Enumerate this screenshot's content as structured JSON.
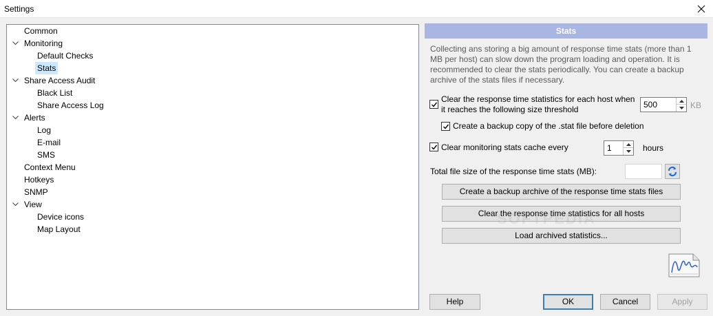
{
  "window": {
    "title": "Settings"
  },
  "tree": {
    "items": [
      {
        "label": "Common",
        "expanded": null,
        "level": 0
      },
      {
        "label": "Monitoring",
        "expanded": true,
        "level": 0
      },
      {
        "label": "Default Checks",
        "expanded": null,
        "level": 1
      },
      {
        "label": "Stats",
        "expanded": null,
        "level": 1,
        "selected": true
      },
      {
        "label": "Share Access Audit",
        "expanded": true,
        "level": 0
      },
      {
        "label": "Black List",
        "expanded": null,
        "level": 1
      },
      {
        "label": "Share Access Log",
        "expanded": null,
        "level": 1
      },
      {
        "label": "Alerts",
        "expanded": true,
        "level": 0
      },
      {
        "label": "Log",
        "expanded": null,
        "level": 1
      },
      {
        "label": "E-mail",
        "expanded": null,
        "level": 1
      },
      {
        "label": "SMS",
        "expanded": null,
        "level": 1
      },
      {
        "label": "Context Menu",
        "expanded": null,
        "level": 0
      },
      {
        "label": "Hotkeys",
        "expanded": null,
        "level": 0
      },
      {
        "label": "SNMP",
        "expanded": null,
        "level": 0
      },
      {
        "label": "View",
        "expanded": true,
        "level": 0
      },
      {
        "label": "Device icons",
        "expanded": null,
        "level": 1
      },
      {
        "label": "Map Layout",
        "expanded": null,
        "level": 1
      }
    ]
  },
  "panel": {
    "header": "Stats",
    "description": "Collecting ans storing a big amount of response time stats (more than 1 MB per host) can slow down the program loading and operation. It is recommended to clear the stats periodically. You can create a backup archive of the stats files if necessary.",
    "clear_threshold": {
      "checked": true,
      "label_line1": "Clear the response time statistics for each host when",
      "label_line2": "it reaches the following size threshold",
      "value": "500",
      "unit": "KB"
    },
    "backup_copy": {
      "checked": true,
      "label": "Create a backup copy of the .stat file before deletion"
    },
    "clear_cache": {
      "checked": true,
      "label": "Clear monitoring stats cache every",
      "value": "1",
      "unit": "hours"
    },
    "total_size_label": "Total file size of the response time stats (MB):",
    "total_size_value": "",
    "buttons": {
      "create_archive": "Create a backup archive of the response time stats files",
      "clear_all": "Clear the response time statistics for all hosts",
      "load_archived": "Load archived statistics..."
    },
    "watermark": "SOFTPEDIA"
  },
  "footer": {
    "help": "Help",
    "ok": "OK",
    "cancel": "Cancel",
    "apply": "Apply"
  },
  "colors": {
    "header_bg": "#a9b6e3",
    "selection": "#cce8ff",
    "default_button_border": "#3c7fb1"
  }
}
